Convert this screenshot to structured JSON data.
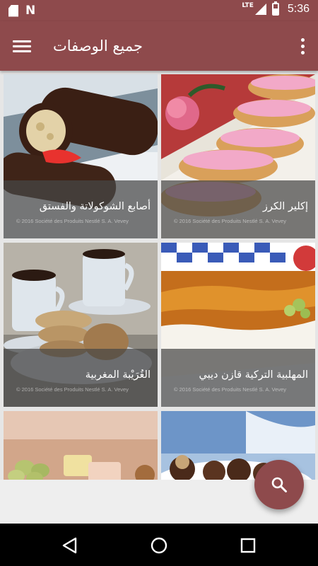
{
  "status_bar": {
    "time": "5:36",
    "network_label": "LTE",
    "battery_level": 0.6,
    "left_icons": [
      "sd-card-icon",
      "n-icon"
    ],
    "right_icons": [
      "signal-icon",
      "battery-icon"
    ]
  },
  "app_bar": {
    "title": "جميع الوصفات",
    "menu_icon": "hamburger-menu-icon",
    "overflow_icon": "more-vert-icon"
  },
  "recipes": [
    {
      "title": "إكلير الكرز",
      "credit": "© 2016  Société des Produits Nestlé S. A. Vevey"
    },
    {
      "title": "أصابع الشوكولاتة والفستق",
      "credit": "© 2016  Société des Produits Nestlé S. A. Vevey"
    },
    {
      "title": "المهلبية التركية قازن ديبي",
      "credit": "© 2016  Société des Produits Nestlé S. A. Vevey"
    },
    {
      "title": "الغُرَيْبة المغربية",
      "credit": "© 2016  Société des Produits Nestlé S. A. Vevey"
    },
    {
      "title": "",
      "credit": ""
    },
    {
      "title": "",
      "credit": ""
    }
  ],
  "fab": {
    "icon": "search-icon",
    "accent_color": "#8e4a4c"
  },
  "nav_bar": {
    "icons": [
      "back-icon",
      "home-icon",
      "recents-icon"
    ]
  },
  "colors": {
    "primary": "#8e4a4c",
    "background": "#eeeeee",
    "nav": "#000000"
  }
}
